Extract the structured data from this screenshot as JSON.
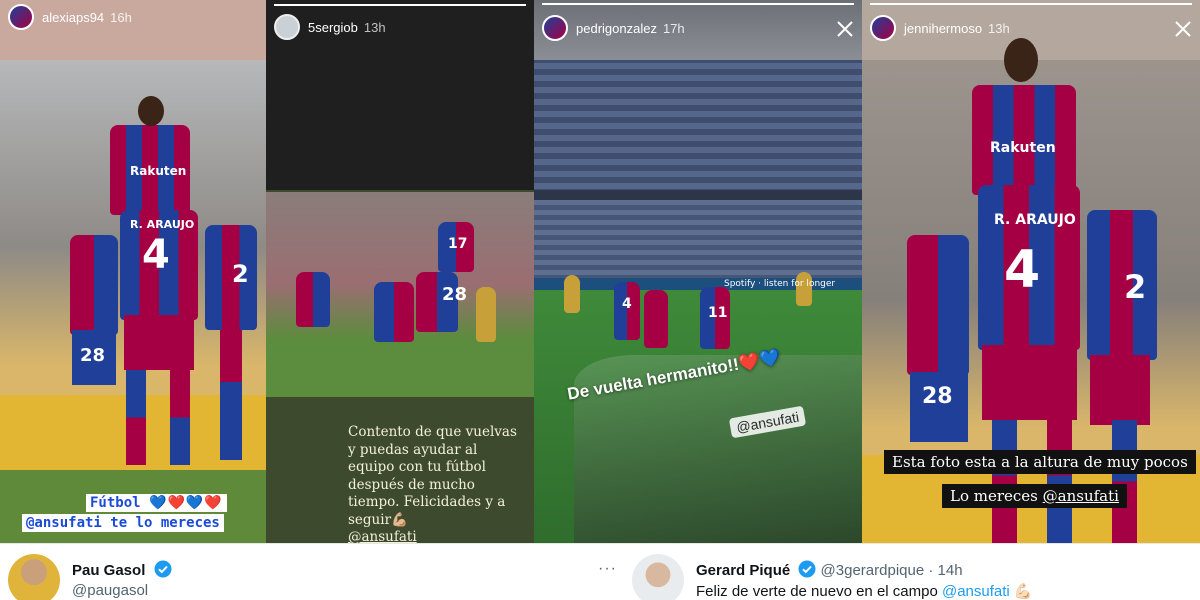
{
  "stories": [
    {
      "username": "alexiaps94",
      "time": "16h",
      "caption_line1": "Fútbol",
      "caption_hearts": "💙❤️💙❤️",
      "caption_line2": "@ansufati te lo mereces",
      "jersey_numbers": [
        "4",
        "28",
        "2"
      ],
      "sponsor": "Rakuten",
      "player_name": "R. ARAUJO"
    },
    {
      "username": "5sergiob",
      "time": "13h",
      "caption": "Contento de que vuelvas y puedas ayudar al equipo con tu fútbol después de mucho tiempo. Felicidades y a seguir💪🏼",
      "mention": "@ansufati",
      "jersey_numbers": [
        "28",
        "17"
      ]
    },
    {
      "username": "pedrigonzalez",
      "time": "17h",
      "banner": "De vuelta hermanito!!❤️💙",
      "mention": "@ansufati",
      "jersey_numbers": [
        "4",
        "11"
      ],
      "ad_text": "Spotify · listen for longer"
    },
    {
      "username": "jennihermoso",
      "time": "13h",
      "caption_line1": "Esta foto esta a la altura de muy pocos",
      "caption_line2": "Lo mereces",
      "mention": "@ansufati",
      "jersey_numbers": [
        "4",
        "28",
        "2"
      ],
      "sponsor": "Rakuten",
      "player_name": "R. ARAUJO"
    }
  ],
  "tweets": [
    {
      "name": "Pau Gasol",
      "handle": "@paugasol",
      "verified": true,
      "more": "···"
    },
    {
      "name": "Gerard Piqué",
      "handle": "@3gerardpique",
      "time": "14h",
      "separator": "·",
      "verified": true,
      "more": "···",
      "text": "Feliz de verte de nuevo en el campo",
      "mention": "@ansufati",
      "emoji": "💪🏻"
    }
  ],
  "colors": {
    "barca_blue": "#1f3f99",
    "barca_red": "#a50044",
    "twitter_blue": "#1d9bf0",
    "verified_blue": "#1d9bf0"
  }
}
